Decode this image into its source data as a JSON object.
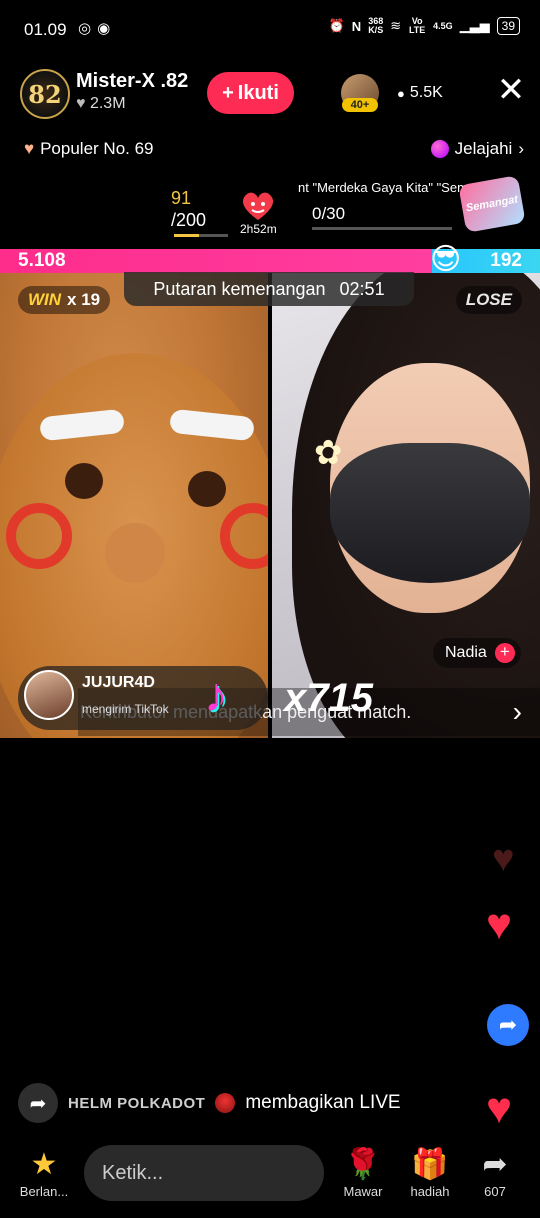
{
  "status_bar": {
    "time": "01.09",
    "net_speed": "368",
    "net_unit": "K/S",
    "volte": "Vo LTE",
    "signal": "4.5G",
    "battery": "39"
  },
  "host": {
    "avatar_text": "82",
    "name": "Mister-X .82",
    "likes": "2.3M",
    "follow_label": "Ikuti"
  },
  "viewers": {
    "badge": "40+",
    "count": "5.5K"
  },
  "popular_label": "Populer No. 69",
  "explore_label": "Jelajahi",
  "goal": {
    "current": "91",
    "total": "/200",
    "fill_fraction": 0.455,
    "timer": "2h52m",
    "marquee": "nt \"Merdeka Gaya Kita\" \"Semangat",
    "progress": "0/30",
    "sticker_text": "Semangat"
  },
  "battle": {
    "left_score": "5.108",
    "right_score": "192",
    "left_fraction": 0.8,
    "round_label": "Putaran kemenangan",
    "round_time": "02:51",
    "win_label": "WIN",
    "win_streak": "x 19",
    "lose_label": "LOSE",
    "opponent_name": "Nadia"
  },
  "gift": {
    "sender": "JUJUR4D",
    "action": "mengirim TikTok",
    "count": "x715",
    "boost_text": "Kontributor mendapatkan penguat match."
  },
  "share_notice": {
    "user": "HELM POLKADOT",
    "text": "membagikan LIVE"
  },
  "bottom_bar": {
    "star_label": "Berlan...",
    "comment_placeholder": "Ketik...",
    "rose_label": "Mawar",
    "gift_label": "hadiah",
    "share_count": "607"
  },
  "colors": {
    "accent": "#fe2c55",
    "battle_left": "#fe2c8b",
    "battle_right": "#29c6ff",
    "win_gold": "#ffd23c"
  },
  "icons": [
    "instagram-icon",
    "chrome-icon",
    "alarm-icon",
    "nfc-icon",
    "wifi-icon",
    "signal-icon",
    "battery-icon",
    "heart-icon",
    "person-icon",
    "close-icon",
    "chevron-right-icon",
    "share-icon",
    "rose-icon",
    "gift-icon",
    "star-icon"
  ]
}
